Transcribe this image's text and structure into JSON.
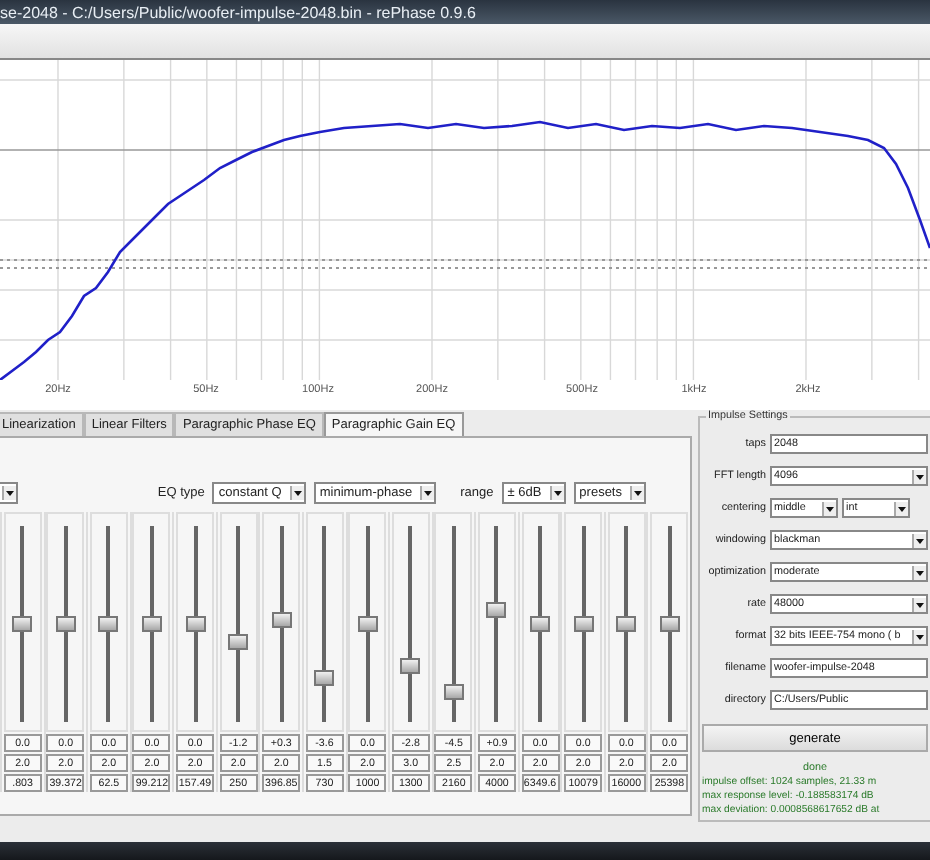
{
  "window": {
    "title": "se-2048  -  C:/Users/Public/woofer-impulse-2048.bin  -  rePhase 0.9.6"
  },
  "graph": {
    "x_labels": [
      "20Hz",
      "50Hz",
      "100Hz",
      "200Hz",
      "500Hz",
      "1kHz",
      "2kHz"
    ]
  },
  "tabs": [
    {
      "label": "Linearization",
      "selected": false
    },
    {
      "label": "Linear Filters",
      "selected": false
    },
    {
      "label": "Paragraphic Phase EQ",
      "selected": false
    },
    {
      "label": "Paragraphic Gain EQ",
      "selected": true
    }
  ],
  "eq_controls": [
    {
      "kind": "label",
      "text": "EQ type"
    },
    {
      "kind": "select",
      "text": "constant Q"
    },
    {
      "kind": "select",
      "text": "minimum-phase"
    },
    {
      "kind": "label",
      "text": "range"
    },
    {
      "kind": "select",
      "text": "± 6dB"
    },
    {
      "kind": "select",
      "text": "presets"
    }
  ],
  "bands": [
    {
      "gain": "0.0",
      "q": "2.0",
      "frequency": ".803",
      "level": 0.5
    },
    {
      "gain": "0.0",
      "q": "2.0",
      "frequency": "39.372",
      "level": 0.5
    },
    {
      "gain": "0.0",
      "q": "2.0",
      "frequency": "62.5",
      "level": 0.5
    },
    {
      "gain": "0.0",
      "q": "2.0",
      "frequency": "99.212",
      "level": 0.5
    },
    {
      "gain": "0.0",
      "q": "2.0",
      "frequency": "157.49",
      "level": 0.5
    },
    {
      "gain": "-1.2",
      "q": "2.0",
      "frequency": "250",
      "level": 0.4
    },
    {
      "gain": "+0.3",
      "q": "2.0",
      "frequency": "396.85",
      "level": 0.525
    },
    {
      "gain": "-3.6",
      "q": "1.5",
      "frequency": "730",
      "level": 0.2
    },
    {
      "gain": "0.0",
      "q": "2.0",
      "frequency": "1000",
      "level": 0.5
    },
    {
      "gain": "-2.8",
      "q": "3.0",
      "frequency": "1300",
      "level": 0.267
    },
    {
      "gain": "-4.5",
      "q": "2.5",
      "frequency": "2160",
      "level": 0.125
    },
    {
      "gain": "+0.9",
      "q": "2.0",
      "frequency": "4000",
      "level": 0.575
    },
    {
      "gain": "0.0",
      "q": "2.0",
      "frequency": "6349.6",
      "level": 0.5
    },
    {
      "gain": "0.0",
      "q": "2.0",
      "frequency": "10079",
      "level": 0.5
    },
    {
      "gain": "0.0",
      "q": "2.0",
      "frequency": "16000",
      "level": 0.5
    },
    {
      "gain": "0.0",
      "q": "2.0",
      "frequency": "25398",
      "level": 0.5
    }
  ],
  "impulse_settings": {
    "legend": "Impulse Settings",
    "fields": [
      {
        "label": "taps",
        "kind": "text",
        "value": "2048"
      },
      {
        "label": "FFT length",
        "kind": "select",
        "value": "4096"
      },
      {
        "label": "centering",
        "kind": "select-pair",
        "value": "middle",
        "value_2": "int"
      },
      {
        "label": "windowing",
        "kind": "select",
        "value": "blackman"
      },
      {
        "label": "optimization",
        "kind": "select",
        "value": "moderate"
      },
      {
        "label": "rate",
        "kind": "select",
        "value": "48000"
      },
      {
        "label": "format",
        "kind": "select",
        "value": "32 bits IEEE-754 mono ( b"
      },
      {
        "label": "filename",
        "kind": "text",
        "value": "woofer-impulse-2048"
      },
      {
        "label": "directory",
        "kind": "text",
        "value": "C:/Users/Public"
      }
    ],
    "generate_button": "generate",
    "status": "done",
    "messages": [
      "impulse offset: 1024 samples, 21.33 m",
      "max response level: -0.188583174 dB",
      "max deviation: 0.0008568617652 dB at"
    ]
  }
}
